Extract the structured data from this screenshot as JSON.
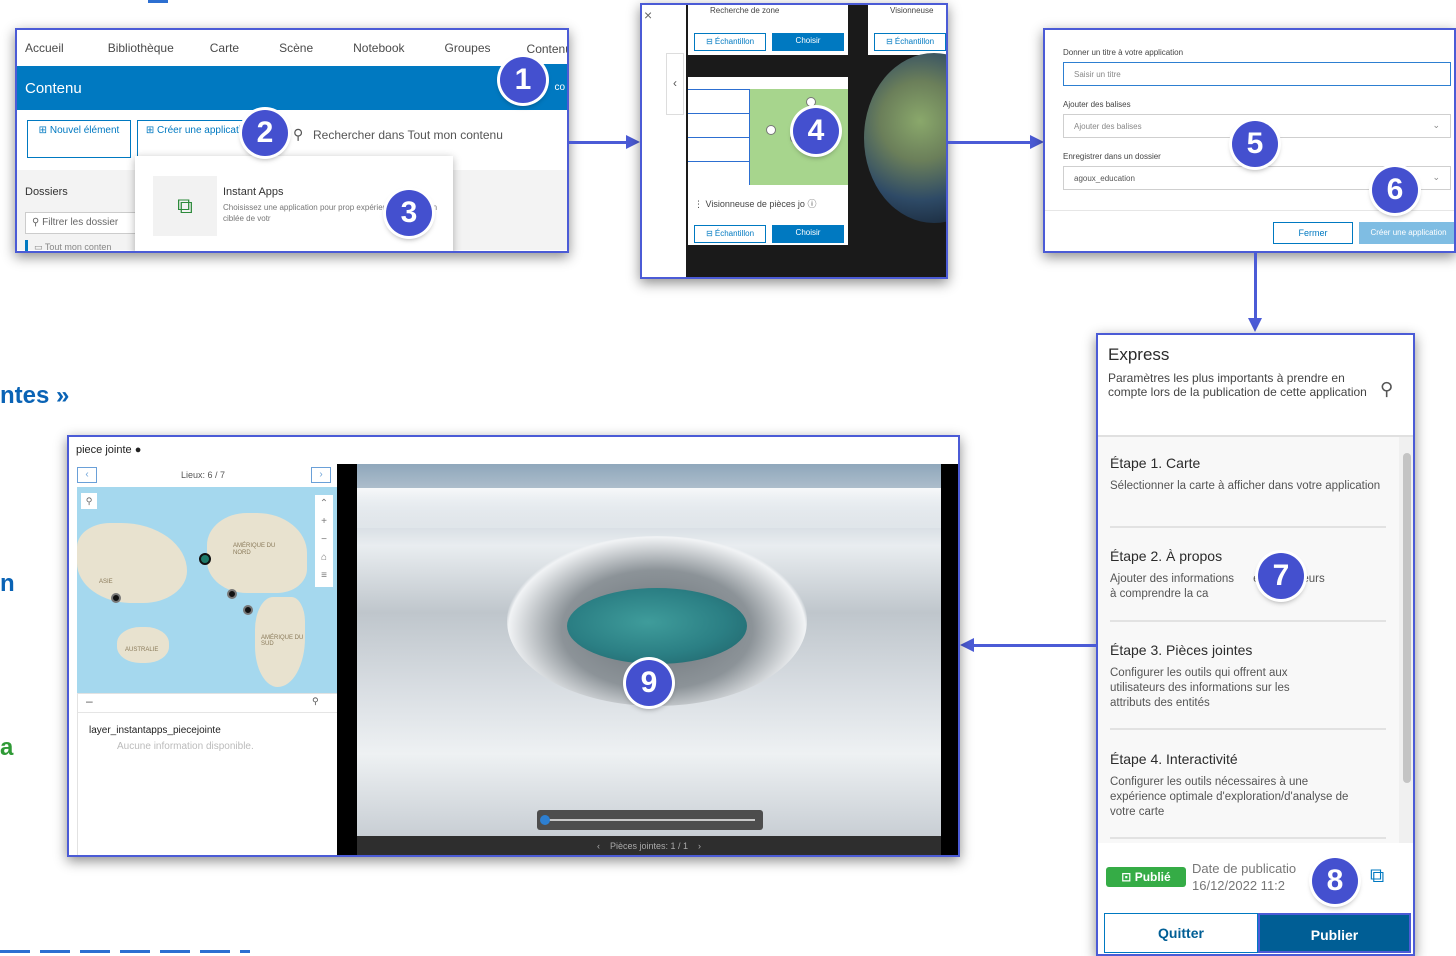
{
  "side_texts": [
    {
      "text": "ntes »",
      "color": "#0a63b5"
    },
    {
      "text": "n",
      "color": "#0a63b5"
    },
    {
      "text": "a",
      "color": "#2f9a36"
    }
  ],
  "badges": [
    "1",
    "2",
    "3",
    "4",
    "5",
    "6",
    "7",
    "8",
    "9"
  ],
  "panel1": {
    "nav": [
      "Accueil",
      "Bibliothèque",
      "Carte",
      "Scène",
      "Notebook",
      "Groupes",
      "Contenu"
    ],
    "band_title": "Contenu",
    "band_cut": "co",
    "new_item": "Nouvel élément",
    "create_app": "Créer une application",
    "search": "Rechercher dans Tout mon contenu",
    "folders": "Dossiers",
    "filter": "Filtrer les dossier",
    "all_content": "Tout mon conten",
    "dropdown_title": "Instant Apps",
    "dropdown_desc": "Choisissez une application pour prop expérience d'utilisation ciblée de votr"
  },
  "panel2": {
    "card_top_title": "Recherche de zone",
    "card_top_right_title": "Visionneuse",
    "sample": "Échantillon",
    "choose": "Choisir",
    "card_bottom_title": "Visionneuse de pièces jo",
    "close": "×"
  },
  "panel3": {
    "title_label": "Donner un titre à votre application",
    "title_placeholder": "Saisir un titre",
    "tags_label": "Ajouter des balises",
    "tags_placeholder": "Ajouter des balises",
    "folder_label": "Enregistrer dans un dossier",
    "folder_value": "agoux_education",
    "close": "Fermer",
    "create": "Créer une application"
  },
  "panel4": {
    "title": "Express",
    "subtitle": "Paramètres les plus importants à prendre en compte lors de la publication de cette application",
    "steps": [
      {
        "title": "Étape 1. Carte",
        "desc": "Sélectionner la carte à afficher dans votre application"
      },
      {
        "title": "Étape 2. À propos",
        "desc": "Ajouter des informations      er les lecteurs à comprendre la ca"
      },
      {
        "title": "Étape 3. Pièces jointes",
        "desc": "Configurer les outils qui offrent aux utilisateurs des informations sur les attributs des entités"
      },
      {
        "title": "Étape 4. Interactivité",
        "desc": "Configurer les outils nécessaires à une expérience optimale d'exploration/d'analyse de votre carte"
      }
    ],
    "published": "Publié",
    "date_label": "Date de publicatio",
    "date_value": "16/12/2022 11:2",
    "quit": "Quitter",
    "publish": "Publier"
  },
  "panel5": {
    "title": "piece jointe",
    "locations": "Lieux: 6 / 7",
    "layer_name": "layer_instantapps_piecejointe",
    "no_info": "Aucune information disponible.",
    "attachments": "Pièces jointes: 1 / 1",
    "map_labels": [
      "AMÉRIQUE DU NORD",
      "ASIE",
      "AMÉRIQUE DU SUD",
      "AUSTRALIE"
    ]
  },
  "colors": {
    "accent": "#0079c1",
    "frame": "#4b5bd6",
    "badge": "#4450cf",
    "published": "#35ac46",
    "publish_btn": "#005e95"
  }
}
